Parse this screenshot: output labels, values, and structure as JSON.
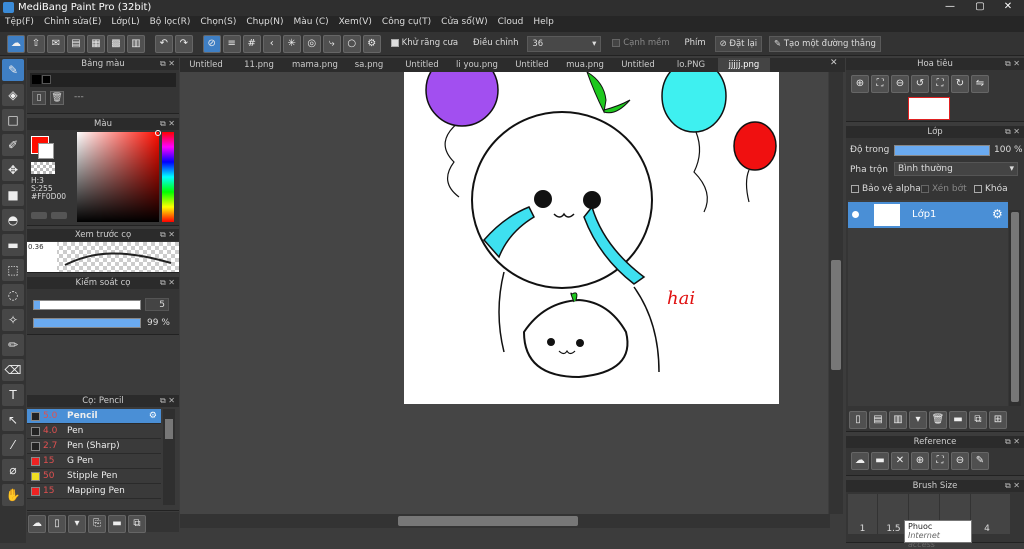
{
  "window": {
    "title": "MediBang Paint Pro (32bit)",
    "controls": [
      "—",
      "▢",
      "✕"
    ]
  },
  "menu": [
    "Tệp(F)",
    "Chỉnh sửa(E)",
    "Lớp(L)",
    "Bộ lọc(R)",
    "Chọn(S)",
    "Chụp(N)",
    "Màu (C)",
    "Xem(V)",
    "Công cụ(T)",
    "Cửa sổ(W)",
    "Cloud",
    "Help"
  ],
  "toolbar": {
    "antialias_label": "Khử răng cưa",
    "adjust_label": "Điều chỉnh",
    "adjust_value": "36",
    "edge_label": "Cạnh mềm",
    "key_label": "Phím",
    "reset_label": "Đặt lại",
    "create_line_label": "Tạo một đường thẳng"
  },
  "palette": {
    "title": "Bảng màu",
    "text": "---"
  },
  "color": {
    "title": "Màu",
    "h": "H:3",
    "s": "S:255",
    "hex": "#FF0D00",
    "current": "#ff0d00"
  },
  "brush_preview": {
    "title": "Xem trước cọ",
    "size": "0.36"
  },
  "brush_control": {
    "title": "Kiểm soát cọ",
    "size": "5",
    "opacity": "99 %"
  },
  "brush_list": {
    "title": "Cọ: Pencil",
    "items": [
      {
        "size": "5.0",
        "name": "Pencil",
        "color": "#222222",
        "active": true
      },
      {
        "size": "4.0",
        "name": "Pen",
        "color": "#222222",
        "active": false
      },
      {
        "size": "2.7",
        "name": "Pen (Sharp)",
        "color": "#222222",
        "active": false
      },
      {
        "size": "15",
        "name": "G Pen",
        "color": "#ee2222",
        "active": false
      },
      {
        "size": "50",
        "name": "Stipple Pen",
        "color": "#eedd22",
        "active": false
      },
      {
        "size": "15",
        "name": "Mapping Pen",
        "color": "#ee2222",
        "active": false
      }
    ]
  },
  "tabs": [
    "Untitled",
    "11.png",
    "mama.png",
    "sa.png",
    "Untitled",
    "li you.png",
    "Untitled",
    "mua.png",
    "Untitled",
    "lo.PNG",
    "jjjjj.png"
  ],
  "navigator": {
    "title": "Hoa tiêu"
  },
  "layers": {
    "title": "Lớp",
    "opacity_label": "Độ trong",
    "opacity_value": "100 %",
    "blend_label": "Pha trộn",
    "blend_value": "Bình thường",
    "protect_alpha": "Bảo vệ alpha",
    "clipping": "Xén bớt",
    "lock": "Khóa",
    "items": [
      {
        "name": "Lớp1"
      }
    ]
  },
  "reference": {
    "title": "Reference"
  },
  "brush_size": {
    "title": "Brush Size",
    "values": [
      "1",
      "1.5",
      "",
      "",
      "4"
    ]
  },
  "tooltip": {
    "line1": "Phuoc",
    "line2": "Internet access"
  },
  "canvas_signature": "hai",
  "colors": {
    "accent": "#5aa0e0",
    "selected": "#4a8fd6",
    "primary": "#ff0d00"
  }
}
